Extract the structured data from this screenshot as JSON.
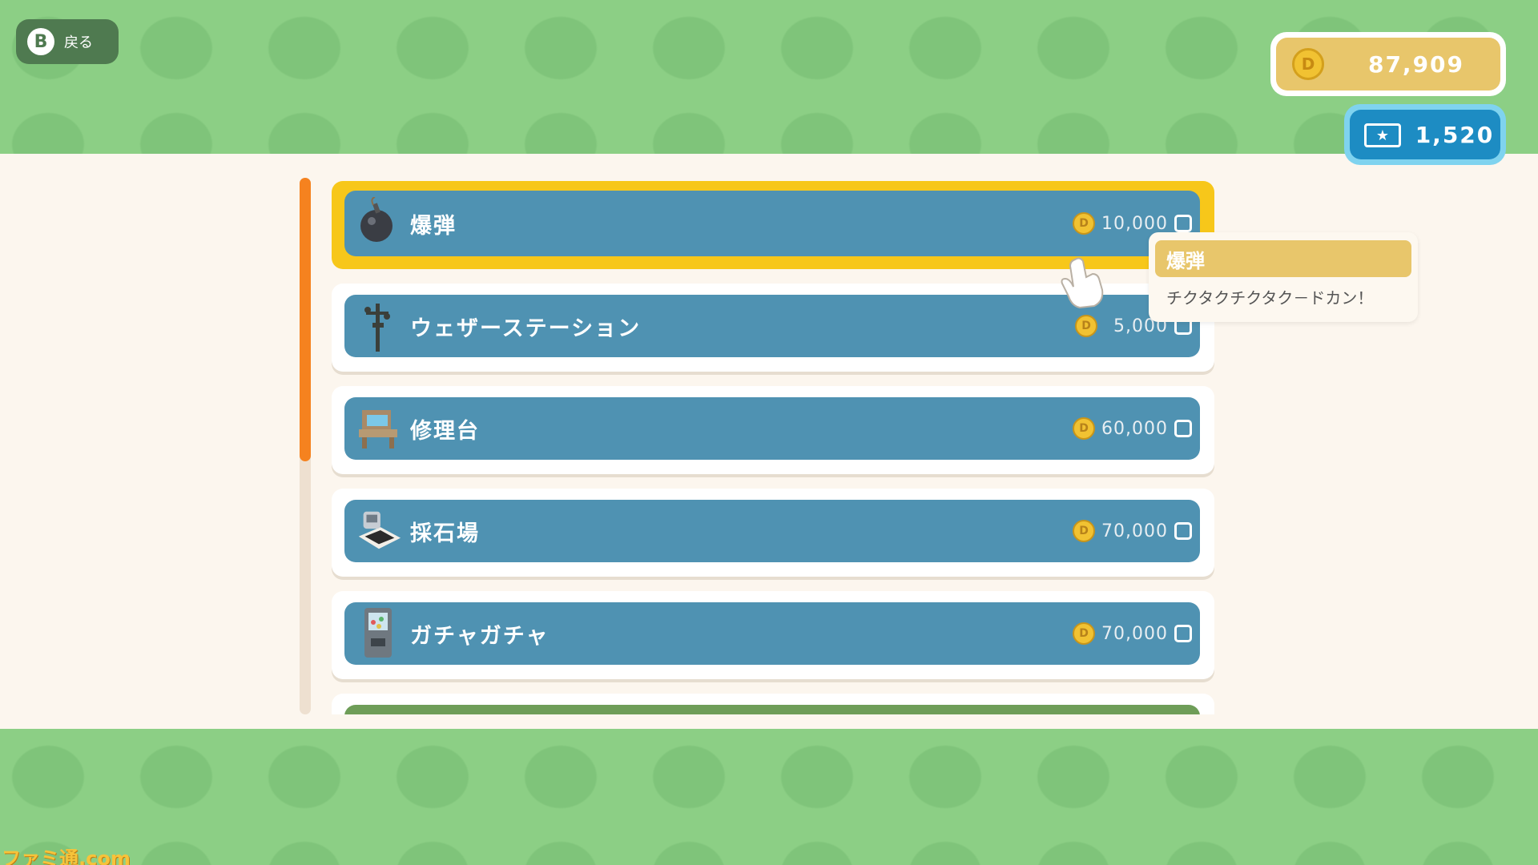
{
  "header": {
    "back_button": {
      "key": "B",
      "label": "戻る"
    },
    "coins": "87,909",
    "tickets": "1,520"
  },
  "items": [
    {
      "name": "爆弾",
      "price": "10,000",
      "icon": "bomb-icon",
      "selected": true
    },
    {
      "name": "ウェザーステーション",
      "price": "5,000",
      "icon": "weather-station-icon"
    },
    {
      "name": "修理台",
      "price": "60,000",
      "icon": "repair-bench-icon"
    },
    {
      "name": "採石場",
      "price": "70,000",
      "icon": "quarry-icon"
    },
    {
      "name": "ガチャガチャ",
      "price": "70,000",
      "icon": "gacha-machine-icon"
    }
  ],
  "tooltip": {
    "title": "爆弾",
    "description": "チクタクチクタク－ドカン！"
  },
  "watermark": "ファミ通.com",
  "colors": {
    "background_green": "#8ccf85",
    "panel": "#fcf6ee",
    "item_bar": "#4f92b2",
    "selection": "#f7c71a",
    "scroll_thumb": "#f5821f",
    "coin_box": "#e8c66b",
    "ticket_box": "#1d8cc3"
  }
}
